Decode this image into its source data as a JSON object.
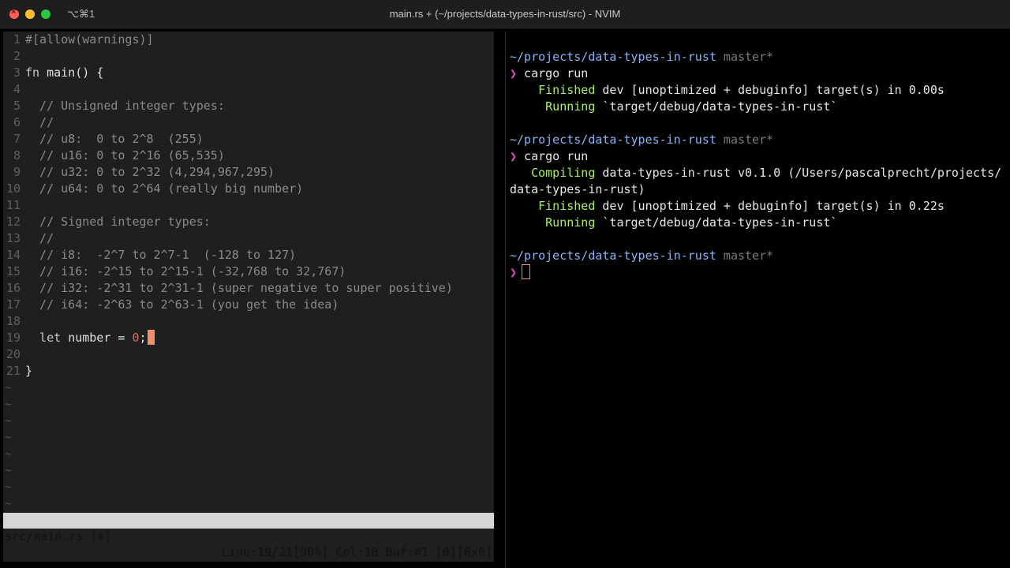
{
  "window": {
    "title": "main.rs + (~/projects/data-types-in-rust/src) - NVIM",
    "shortcut": "⌥⌘1"
  },
  "editor": {
    "lines": [
      {
        "n": "1",
        "parts": [
          {
            "t": "#[allow(warnings)]",
            "c": "cm"
          }
        ]
      },
      {
        "n": "2",
        "parts": []
      },
      {
        "n": "3",
        "parts": [
          {
            "t": "fn ",
            "c": "kw"
          },
          {
            "t": "main",
            "c": "fn"
          },
          {
            "t": "() {",
            "c": ""
          }
        ]
      },
      {
        "n": "4",
        "parts": []
      },
      {
        "n": "5",
        "parts": [
          {
            "t": "  // Unsigned integer types:",
            "c": "cm"
          }
        ]
      },
      {
        "n": "6",
        "parts": [
          {
            "t": "  //",
            "c": "cm"
          }
        ]
      },
      {
        "n": "7",
        "parts": [
          {
            "t": "  // u8:  0 to 2^8  (255)",
            "c": "cm"
          }
        ]
      },
      {
        "n": "8",
        "parts": [
          {
            "t": "  // u16: 0 to 2^16 (65,535)",
            "c": "cm"
          }
        ]
      },
      {
        "n": "9",
        "parts": [
          {
            "t": "  // u32: 0 to 2^32 (4,294,967,295)",
            "c": "cm"
          }
        ]
      },
      {
        "n": "10",
        "parts": [
          {
            "t": "  // u64: 0 to 2^64 (really big number)",
            "c": "cm"
          }
        ]
      },
      {
        "n": "11",
        "parts": []
      },
      {
        "n": "12",
        "parts": [
          {
            "t": "  // Signed integer types:",
            "c": "cm"
          }
        ]
      },
      {
        "n": "13",
        "parts": [
          {
            "t": "  //",
            "c": "cm"
          }
        ]
      },
      {
        "n": "14",
        "parts": [
          {
            "t": "  // i8:  -2^7 to 2^7-1  (-128 to 127)",
            "c": "cm"
          }
        ]
      },
      {
        "n": "15",
        "parts": [
          {
            "t": "  // i16: -2^15 to 2^15-1 (-32,768 to 32,767)",
            "c": "cm"
          }
        ]
      },
      {
        "n": "16",
        "parts": [
          {
            "t": "  // i32: -2^31 to 2^31-1 (super negative to super positive)",
            "c": "cm"
          }
        ]
      },
      {
        "n": "17",
        "parts": [
          {
            "t": "  // i64: -2^63 to 2^63-1 (you get the idea)",
            "c": "cm"
          }
        ]
      },
      {
        "n": "18",
        "parts": []
      },
      {
        "n": "19",
        "parts": [
          {
            "t": "  let ",
            "c": "kw"
          },
          {
            "t": "number = ",
            "c": ""
          },
          {
            "t": "0",
            "c": "num"
          },
          {
            "t": ";",
            "c": ""
          }
        ],
        "cursor": true
      },
      {
        "n": "20",
        "parts": []
      },
      {
        "n": "21",
        "parts": [
          {
            "t": "}",
            "c": ""
          }
        ]
      }
    ],
    "empty_lines": [
      "~",
      "~",
      "~",
      "~",
      "~",
      "~",
      "~",
      "~"
    ]
  },
  "statusbar": {
    "left": "src/main.rs [+]",
    "right": "Line:19/21[90%] Col:18 Buf:#1 [0][0x0]"
  },
  "terminal": {
    "lines": [
      {
        "parts": [
          {
            "t": "~/projects/data-types-in-rust",
            "c": "path"
          },
          {
            "t": " master*",
            "c": "branch"
          }
        ]
      },
      {
        "parts": [
          {
            "t": "❯",
            "c": "prompt"
          },
          {
            "t": " cargo run",
            "c": ""
          }
        ]
      },
      {
        "parts": [
          {
            "t": "    Finished",
            "c": "ok"
          },
          {
            "t": " dev [unoptimized + debuginfo] target(s) in 0.00s",
            "c": ""
          }
        ]
      },
      {
        "parts": [
          {
            "t": "     Running",
            "c": "ok"
          },
          {
            "t": " `target/debug/data-types-in-rust`",
            "c": ""
          }
        ]
      },
      {
        "parts": []
      },
      {
        "parts": [
          {
            "t": "~/projects/data-types-in-rust",
            "c": "path"
          },
          {
            "t": " master*",
            "c": "branch"
          }
        ]
      },
      {
        "parts": [
          {
            "t": "❯",
            "c": "prompt"
          },
          {
            "t": " cargo run",
            "c": ""
          }
        ]
      },
      {
        "parts": [
          {
            "t": "   Compiling",
            "c": "ok"
          },
          {
            "t": " data-types-in-rust v0.1.0 (/Users/pascalprecht/projects/",
            "c": ""
          }
        ]
      },
      {
        "parts": [
          {
            "t": "data-types-in-rust)",
            "c": ""
          }
        ]
      },
      {
        "parts": [
          {
            "t": "    Finished",
            "c": "ok"
          },
          {
            "t": " dev [unoptimized + debuginfo] target(s) in 0.22s",
            "c": ""
          }
        ]
      },
      {
        "parts": [
          {
            "t": "     Running",
            "c": "ok"
          },
          {
            "t": " `target/debug/data-types-in-rust`",
            "c": ""
          }
        ]
      },
      {
        "parts": []
      },
      {
        "parts": [
          {
            "t": "~/projects/data-types-in-rust",
            "c": "path"
          },
          {
            "t": " master*",
            "c": "branch"
          }
        ]
      },
      {
        "parts": [
          {
            "t": "❯",
            "c": "prompt"
          }
        ],
        "cursor": true
      }
    ]
  }
}
